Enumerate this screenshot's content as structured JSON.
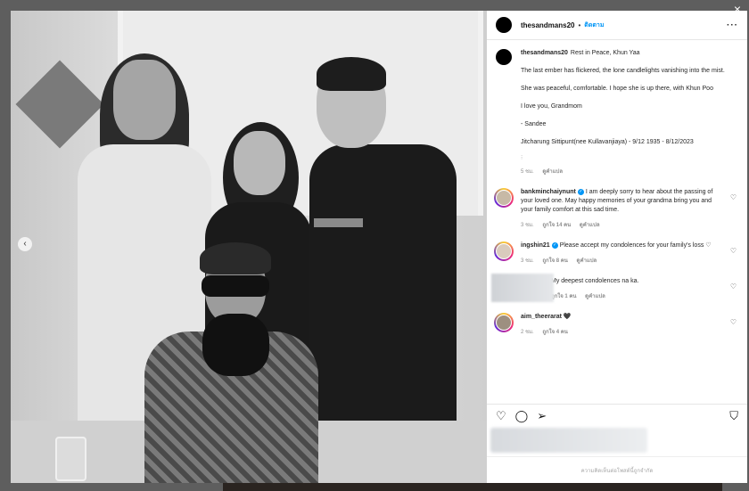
{
  "window": {
    "close_icon": "×",
    "prev_icon": "‹",
    "next_icon": "›"
  },
  "post": {
    "username": "thesandmans20",
    "dot": "•",
    "follow_label": "ติดตาม",
    "more_icon": "···"
  },
  "caption": {
    "username": "thesandmans20",
    "title": "Rest in Peace, Khun Yaa",
    "paragraphs": [
      "The last ember has flickered, the lone candlelights vanishing into the mist.",
      "She was peaceful, comfortable. I hope she is up there, with Khun Poo",
      "I love you, Grandmom",
      "- Sandee",
      "Jitcharung Sittipunt(nee Kullavanjiaya) - 9/12 1935 - 8/12/2023"
    ],
    "time": "5 ชม.",
    "translate": "ดูคำแปล"
  },
  "comments": [
    {
      "username": "bankminchaiynunt",
      "verified": true,
      "text": "I am deeply sorry to hear about the passing of your loved one. May happy memories of your grandma bring you and your family comfort at this sad time.",
      "time": "3 ชม.",
      "likes": "ถูกใจ 14 คน",
      "translate": "ดูคำแปล"
    },
    {
      "username": "ingshin21",
      "verified": true,
      "text": "Please accept my condolences for your family's loss ♡",
      "time": "3 ชม.",
      "likes": "ถูกใจ 8 คน",
      "translate": "ดูคำแปล"
    },
    {
      "username": "",
      "verified": false,
      "text": "My deepest condolences na ka.",
      "time": "",
      "likes": "ถูกใจ 1 คน",
      "translate": "ดูคำแปล"
    },
    {
      "username": "aim_theerarat",
      "verified": false,
      "text": "🖤",
      "time": "2 ชม.",
      "likes": "ถูกใจ 4 คน",
      "translate": ""
    }
  ],
  "actions": {
    "like_icon": "♡",
    "comment_icon": "◯",
    "share_icon": "➢",
    "save_icon": "⛉"
  },
  "comment_box": {
    "placeholder": "ความคิดเห็นต่อโพสต์นี้ถูกจำกัด"
  }
}
